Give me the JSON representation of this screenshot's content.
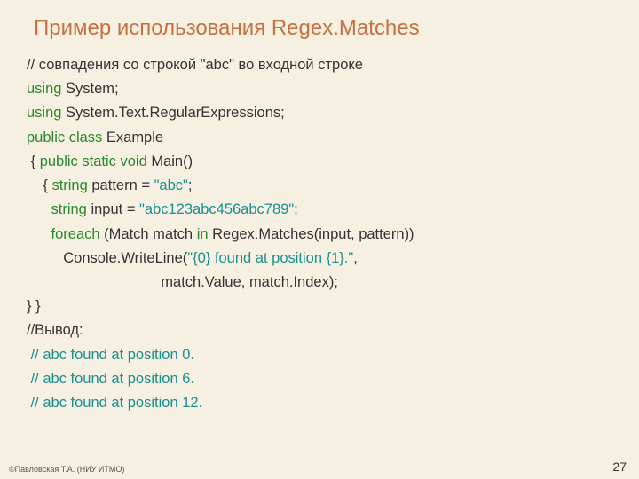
{
  "title": "Пример использования Regex.Matches",
  "lines": {
    "l1": "// совпадения со строкой \"abc\" во входной строке",
    "l2a": "using",
    "l2b": " System;",
    "l3a": "using",
    "l3b": " System.Text.RegularExpressions;",
    "l4a": "public class",
    "l4b": " Example",
    "l5a": " { ",
    "l5b": "public static void",
    "l5c": " Main()",
    "l6a": "    { ",
    "l6b": "string",
    "l6c": " pattern = ",
    "l6d": "\"abc\"",
    "l6e": ";",
    "l7a": "      ",
    "l7b": "string",
    "l7c": " input = ",
    "l7d": "\"abc123abc456abc789\"",
    "l7e": ";",
    "l8a": "      ",
    "l8b": "foreach",
    "l8c": " (Match match ",
    "l8d": "in",
    "l8e": " Regex.Matches(input, pattern))",
    "l9a": "         Console.WriteLine(",
    "l9b": "\"{0} found at position {1}.\"",
    "l9c": ",",
    "l10": "                                 match.Value, match.Index);",
    "l11": "} }",
    "l12": "//Вывод:",
    "l13": " // abc found at position 0.",
    "l14": " // abc found at position 6.",
    "l15": " // abc found at position 12."
  },
  "footerLeft": "©Павловская Т.А. (НИУ ИТМО)",
  "pageNumber": "27"
}
